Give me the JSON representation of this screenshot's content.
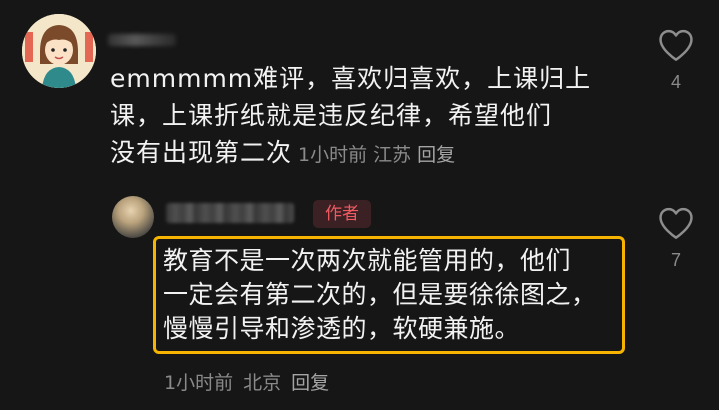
{
  "comment": {
    "text_lines": [
      "emmmmm难评，喜欢归喜欢，上课归上",
      "课，上课折纸就是违反纪律，希望他们",
      "没有出现第二次"
    ],
    "time": "1小时前",
    "location": "江苏",
    "reply_label": "回复",
    "like_count": "4",
    "avatar_icon": "cartoon-girl-avatar",
    "like_icon": "heart-outline-icon"
  },
  "reply": {
    "author_badge": "作者",
    "text_lines": [
      "教育不是一次两次就能管用的，他们",
      "一定会有第二次的，但是要徐徐图之，",
      "慢慢引导和渗透的，软硬兼施。"
    ],
    "time": "1小时前",
    "location": "北京",
    "reply_label": "回复",
    "like_count": "7",
    "highlight_color": "#f6b400"
  },
  "colors": {
    "background": "#161616",
    "text": "#f2f2f2",
    "meta": "#8a8a8a",
    "badge_text": "#f05a63",
    "badge_bg": "#3b2124"
  }
}
